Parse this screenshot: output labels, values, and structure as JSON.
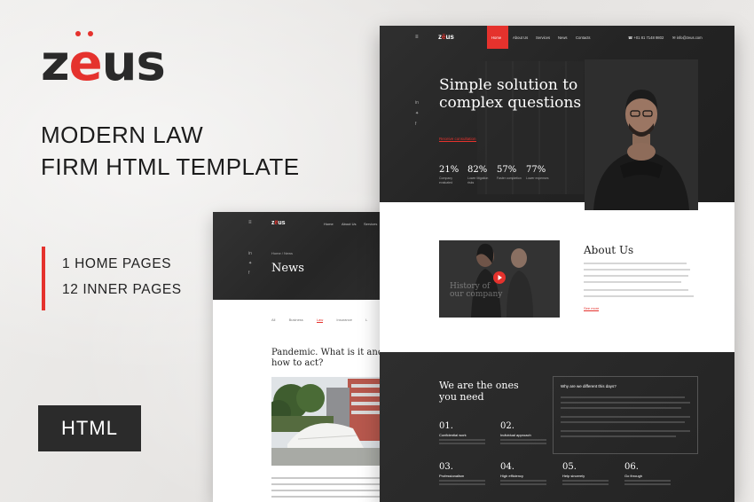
{
  "promo": {
    "logo_prefix": "z",
    "logo_e": "e",
    "logo_suffix": "us",
    "title_line1": "MODERN LAW",
    "title_line2": "FIRM HTML TEMPLATE",
    "feature1": "1 HOME PAGES",
    "feature2": "12 INNER PAGES",
    "badge": "HTML"
  },
  "colors": {
    "accent": "#e5322d",
    "dark": "#2b2b2b",
    "paper": "#eceae8"
  },
  "news_page": {
    "logo_prefix": "z",
    "logo_e": "ë",
    "logo_suffix": "us",
    "nav": [
      "Home",
      "About Us",
      "Services"
    ],
    "breadcrumb": "Home  /  News",
    "title": "News",
    "filters": [
      "All",
      "Business",
      "Law",
      "Insurance",
      "L"
    ],
    "article_title": "Pandemic. What is it and how to act?"
  },
  "main_page": {
    "logo_prefix": "z",
    "logo_e": "ë",
    "logo_suffix": "us",
    "nav": [
      "Home",
      "About Us",
      "Services",
      "News",
      "Contacts"
    ],
    "phone": "+01 81 7148 9802",
    "email": "info@zeus.com",
    "hero_title": "Simple solution to complex questions",
    "hero_link": "Receive consultation",
    "stats": [
      {
        "value": "21%",
        "label": "Company evaluated"
      },
      {
        "value": "82%",
        "label": "Lower litigation risks"
      },
      {
        "value": "57%",
        "label": "Faster completion"
      },
      {
        "value": "77%",
        "label": "Lower expenses"
      }
    ],
    "about_image_text": "History of our company",
    "about_title": "About Us",
    "about_link": "See more",
    "why_title": "We are the ones you need",
    "why_box_title": "Why are we different this days?",
    "features": [
      {
        "num": "01.",
        "label": "Confidential work"
      },
      {
        "num": "02.",
        "label": "Individual approach"
      },
      {
        "num": "03.",
        "label": "Professionalism"
      },
      {
        "num": "04.",
        "label": "High efficiency"
      },
      {
        "num": "05.",
        "label": "Help sincerely"
      },
      {
        "num": "06.",
        "label": "Go through"
      }
    ]
  }
}
